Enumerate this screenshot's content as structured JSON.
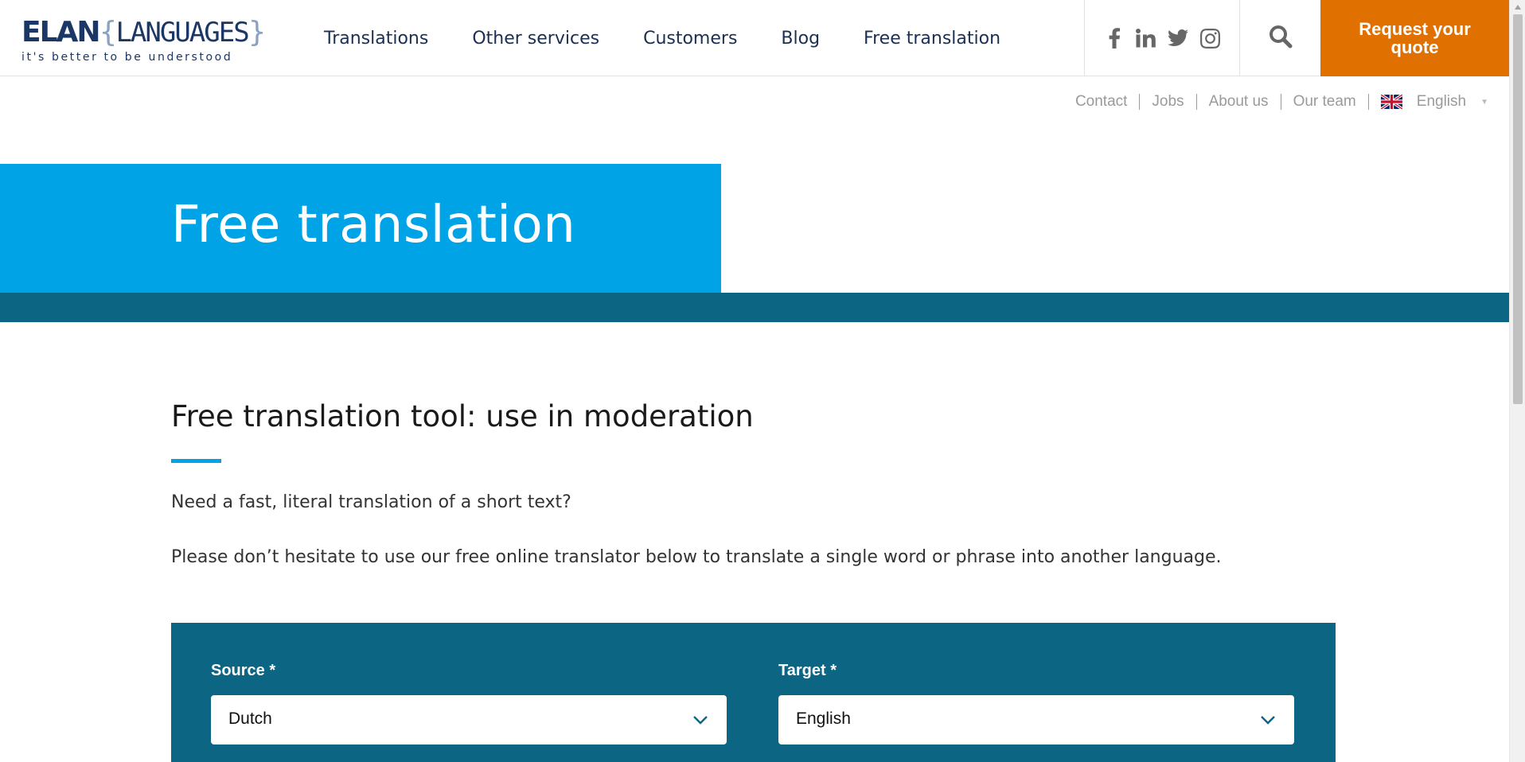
{
  "logo": {
    "brand_bold": "ELAN",
    "brace_open": "{",
    "brand_light": "LANGUAGES",
    "brace_close": "}",
    "tagline": "it's better to be understood"
  },
  "main_nav": [
    {
      "label": "Translations"
    },
    {
      "label": "Other services"
    },
    {
      "label": "Customers"
    },
    {
      "label": "Blog"
    },
    {
      "label": "Free translation"
    }
  ],
  "social_icons": [
    "facebook-icon",
    "linkedin-icon",
    "twitter-icon",
    "instagram-icon"
  ],
  "quote_button": {
    "label": "Request your quote"
  },
  "sub_nav": {
    "links": [
      "Contact",
      "Jobs",
      "About us",
      "Our team"
    ],
    "language": "English",
    "flag_icon": "uk-flag-icon"
  },
  "hero": {
    "title": "Free translation"
  },
  "content": {
    "heading": "Free translation tool: use in moderation",
    "paragraph1": "Need a fast, literal translation of a short text?",
    "paragraph2": "Please don’t hesitate to use our free online translator below to translate a single word or phrase into another language."
  },
  "translator": {
    "source_label": "Source *",
    "source_value": "Dutch",
    "target_label": "Target *",
    "target_value": "English"
  },
  "colors": {
    "accent_blue": "#00a3e6",
    "dark_teal": "#0c6583",
    "brand_orange": "#e07000",
    "brand_navy": "#1b3766"
  }
}
